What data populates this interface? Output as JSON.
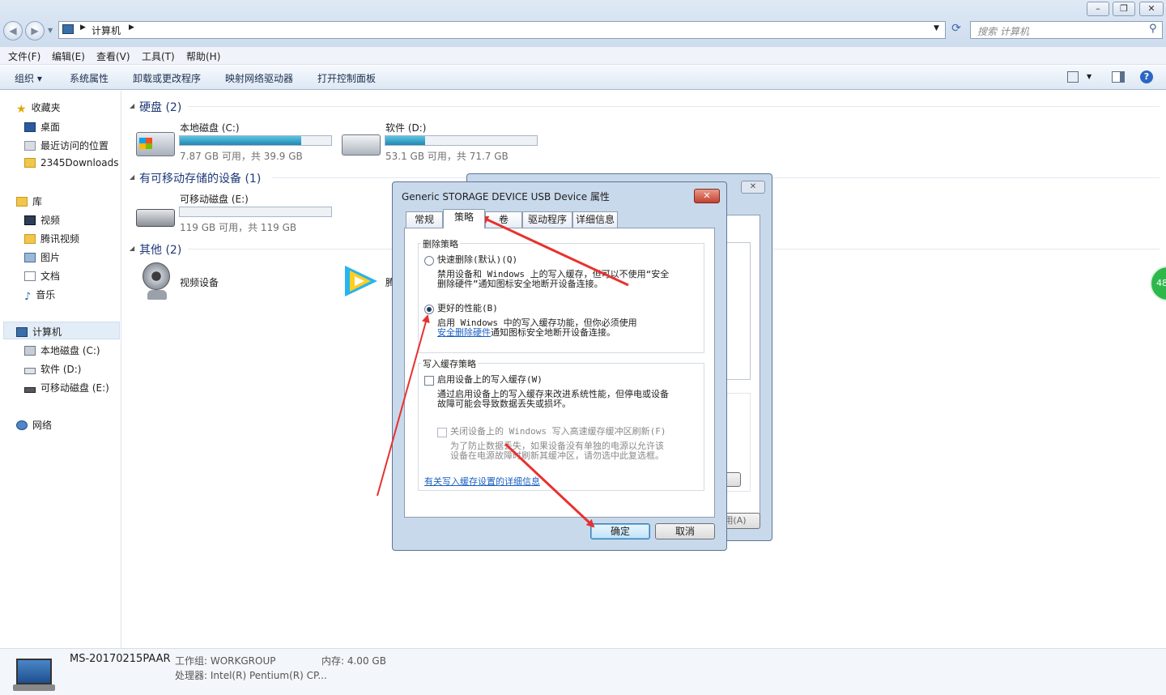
{
  "window": {
    "min_icon": "minimize-icon",
    "max_icon": "maximize-icon",
    "close_icon": "close-icon"
  },
  "address": {
    "crumb": "计算机",
    "search_placeholder": "搜索 计算机"
  },
  "menu": [
    "文件(F)",
    "编辑(E)",
    "查看(V)",
    "工具(T)",
    "帮助(H)"
  ],
  "commands": {
    "organize": "组织 ▾",
    "items": [
      "系统属性",
      "卸载或更改程序",
      "映射网络驱动器",
      "打开控制面板"
    ]
  },
  "sidebar": {
    "favorites": {
      "label": "收藏夹",
      "items": [
        "桌面",
        "最近访问的位置",
        "2345Downloads"
      ]
    },
    "libraries": {
      "label": "库",
      "items": [
        "视频",
        "腾讯视频",
        "图片",
        "文档",
        "音乐"
      ]
    },
    "computer": {
      "label": "计算机",
      "items": [
        "本地磁盘 (C:)",
        "软件 (D:)",
        "可移动磁盘 (E:)"
      ]
    },
    "network": {
      "label": "网络"
    }
  },
  "groups": {
    "hdd": "硬盘 (2)",
    "removable": "有可移动存储的设备 (1)",
    "other": "其他 (2)"
  },
  "drives": {
    "c": {
      "name": "本地磁盘 (C:)",
      "free": "7.87 GB 可用，共 39.9 GB",
      "used_fraction": 0.8
    },
    "d": {
      "name": "软件 (D:)",
      "free": "53.1 GB 可用，共 71.7 GB",
      "used_fraction": 0.26
    },
    "e": {
      "name": "可移动磁盘 (E:)",
      "free": "119 GB 可用，共 119 GB",
      "used_fraction": 0.0
    }
  },
  "other": {
    "camera": "视频设备",
    "tencent_partial": "腾"
  },
  "status": {
    "pc_name": "MS-20170215PAAR",
    "workgroup": "工作组: WORKGROUP",
    "memory": "内存: 4.00 GB",
    "cpu": "处理器: Intel(R) Pentium(R) CP..."
  },
  "badge": "48",
  "back_dialog": {
    "apply_partial": "用(A)"
  },
  "dialog": {
    "title": "Generic STORAGE DEVICE USB Device 属性",
    "tabs": [
      "常规",
      "策略",
      "卷",
      "驱动程序",
      "详细信息"
    ],
    "removal_policy": {
      "label": "删除策略",
      "quick": "快速删除(默认)(Q)",
      "quick_desc1": "禁用设备和 Windows 上的写入缓存，但可以不使用“安全",
      "quick_desc2": "删除硬件”通知图标安全地断开设备连接。",
      "better": "更好的性能(B)",
      "better_desc1": "启用 Windows 中的写入缓存功能，但你必须使用",
      "better_link": "安全删除硬件",
      "better_desc2": "通知图标安全地断开设备连接。",
      "selected": "better"
    },
    "write_cache": {
      "label": "写入缓存策略",
      "enable": "启用设备上的写入缓存(W)",
      "enable_desc1": "通过启用设备上的写入缓存来改进系统性能，但停电或设备",
      "enable_desc2": "故障可能会导致数据丢失或损坏。",
      "flush": "关闭设备上的 Windows 写入高速缓存缓冲区刷新(F)",
      "flush_desc1": "为了防止数据丢失，如果设备没有单独的电源以允许该",
      "flush_desc2": "设备在电源故障时刷新其缓冲区，请勿选中此复选框。",
      "more_link": "有关写入缓存设置的详细信息"
    },
    "ok": "确定",
    "cancel": "取消",
    "annotation_color": "#e8312f"
  }
}
